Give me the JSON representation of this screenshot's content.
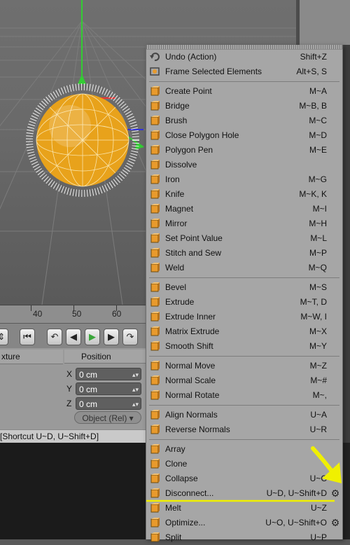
{
  "timeline": {
    "ticks": [
      "40",
      "50",
      "60"
    ]
  },
  "attributes": {
    "left_header": "xture",
    "tab_label": "Position",
    "coords": [
      {
        "axis": "X",
        "value": "0 cm"
      },
      {
        "axis": "Y",
        "value": "0 cm"
      },
      {
        "axis": "Z",
        "value": "0 cm"
      }
    ],
    "mode": "Object (Rel)"
  },
  "status_text": "[Shortcut U~D, U~Shift+D]",
  "menu": {
    "groups": [
      [
        {
          "label": "Undo (Action)",
          "shortcut": "Shift+Z",
          "icon": "undo-icon"
        },
        {
          "label": "Frame Selected Elements",
          "shortcut": "Alt+S, S",
          "icon": "frame-selected-icon"
        }
      ],
      [
        {
          "label": "Create Point",
          "shortcut": "M~A",
          "icon": "create-point-icon"
        },
        {
          "label": "Bridge",
          "shortcut": "M~B, B",
          "icon": "bridge-icon"
        },
        {
          "label": "Brush",
          "shortcut": "M~C",
          "icon": "brush-icon"
        },
        {
          "label": "Close Polygon Hole",
          "shortcut": "M~D",
          "icon": "close-polygon-hole-icon"
        },
        {
          "label": "Polygon Pen",
          "shortcut": "M~E",
          "icon": "polygon-pen-icon"
        },
        {
          "label": "Dissolve",
          "shortcut": "",
          "icon": "dissolve-icon"
        },
        {
          "label": "Iron",
          "shortcut": "M~G",
          "icon": "iron-icon"
        },
        {
          "label": "Knife",
          "shortcut": "M~K, K",
          "icon": "knife-icon"
        },
        {
          "label": "Magnet",
          "shortcut": "M~I",
          "icon": "magnet-icon"
        },
        {
          "label": "Mirror",
          "shortcut": "M~H",
          "icon": "mirror-icon"
        },
        {
          "label": "Set Point Value",
          "shortcut": "M~L",
          "icon": "set-point-value-icon"
        },
        {
          "label": "Stitch and Sew",
          "shortcut": "M~P",
          "icon": "stitch-and-sew-icon"
        },
        {
          "label": "Weld",
          "shortcut": "M~Q",
          "icon": "weld-icon"
        }
      ],
      [
        {
          "label": "Bevel",
          "shortcut": "M~S",
          "icon": "bevel-icon"
        },
        {
          "label": "Extrude",
          "shortcut": "M~T, D",
          "icon": "extrude-icon"
        },
        {
          "label": "Extrude Inner",
          "shortcut": "M~W, I",
          "icon": "extrude-inner-icon"
        },
        {
          "label": "Matrix Extrude",
          "shortcut": "M~X",
          "icon": "matrix-extrude-icon"
        },
        {
          "label": "Smooth Shift",
          "shortcut": "M~Y",
          "icon": "smooth-shift-icon"
        }
      ],
      [
        {
          "label": "Normal Move",
          "shortcut": "M~Z",
          "icon": "normal-move-icon"
        },
        {
          "label": "Normal Scale",
          "shortcut": "M~#",
          "icon": "normal-scale-icon"
        },
        {
          "label": "Normal Rotate",
          "shortcut": "M~,",
          "icon": "normal-rotate-icon"
        }
      ],
      [
        {
          "label": "Align Normals",
          "shortcut": "U~A",
          "icon": "align-normals-icon"
        },
        {
          "label": "Reverse Normals",
          "shortcut": "U~R",
          "icon": "reverse-normals-icon"
        }
      ],
      [
        {
          "label": "Array",
          "shortcut": "",
          "icon": "array-icon"
        },
        {
          "label": "Clone",
          "shortcut": "",
          "icon": "clone-icon"
        },
        {
          "label": "Collapse",
          "shortcut": "U~C",
          "icon": "collapse-icon"
        },
        {
          "label": "Disconnect...",
          "shortcut": "U~D, U~Shift+D",
          "icon": "disconnect-icon",
          "gear": true
        },
        {
          "label": "Melt",
          "shortcut": "U~Z",
          "icon": "melt-icon"
        },
        {
          "label": "Optimize...",
          "shortcut": "U~O, U~Shift+O",
          "icon": "optimize-icon",
          "gear": true
        },
        {
          "label": "Split",
          "shortcut": "U~P",
          "icon": "split-icon"
        }
      ]
    ]
  },
  "colors": {
    "annotation": "#f0f000",
    "sphere": "#e8a21b",
    "accent_orange": "#e89a2c"
  }
}
